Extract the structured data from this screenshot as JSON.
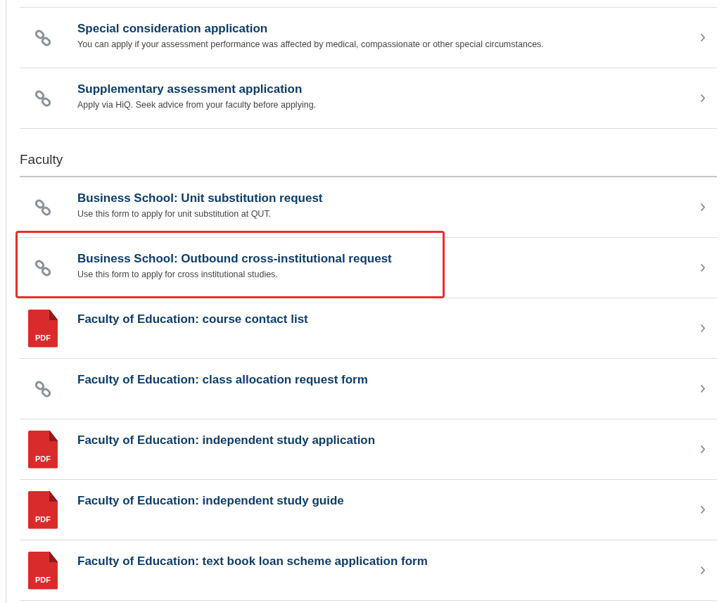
{
  "sections": [
    {
      "items": [
        {
          "kind": "link",
          "title": "Special consideration application",
          "description": "You can apply if your assessment performance was affected by medical, compassionate or other special circumstances.",
          "highlighted": false
        },
        {
          "kind": "link",
          "title": "Supplementary assessment application",
          "description": "Apply via HiQ. Seek advice from your faculty before applying.",
          "highlighted": false
        }
      ]
    },
    {
      "heading": "Faculty",
      "items": [
        {
          "kind": "link",
          "title": "Business School: Unit substitution request",
          "description": "Use this form to apply for unit substitution at QUT.",
          "highlighted": false
        },
        {
          "kind": "link",
          "title": "Business School: Outbound cross-institutional request",
          "description": "Use this form to apply for cross institutional studies.",
          "highlighted": true
        },
        {
          "kind": "pdf",
          "badge": "PDF",
          "title": "Faculty of Education: course contact list",
          "highlighted": false
        },
        {
          "kind": "link",
          "title": "Faculty of Education: class allocation request form",
          "highlighted": false
        },
        {
          "kind": "pdf",
          "badge": "PDF",
          "title": "Faculty of Education: independent study application",
          "highlighted": false
        },
        {
          "kind": "pdf",
          "badge": "PDF",
          "title": "Faculty of Education: independent study guide",
          "highlighted": false
        },
        {
          "kind": "pdf",
          "badge": "PDF",
          "title": "Faculty of Education: text book loan scheme application form",
          "highlighted": false
        }
      ]
    }
  ]
}
